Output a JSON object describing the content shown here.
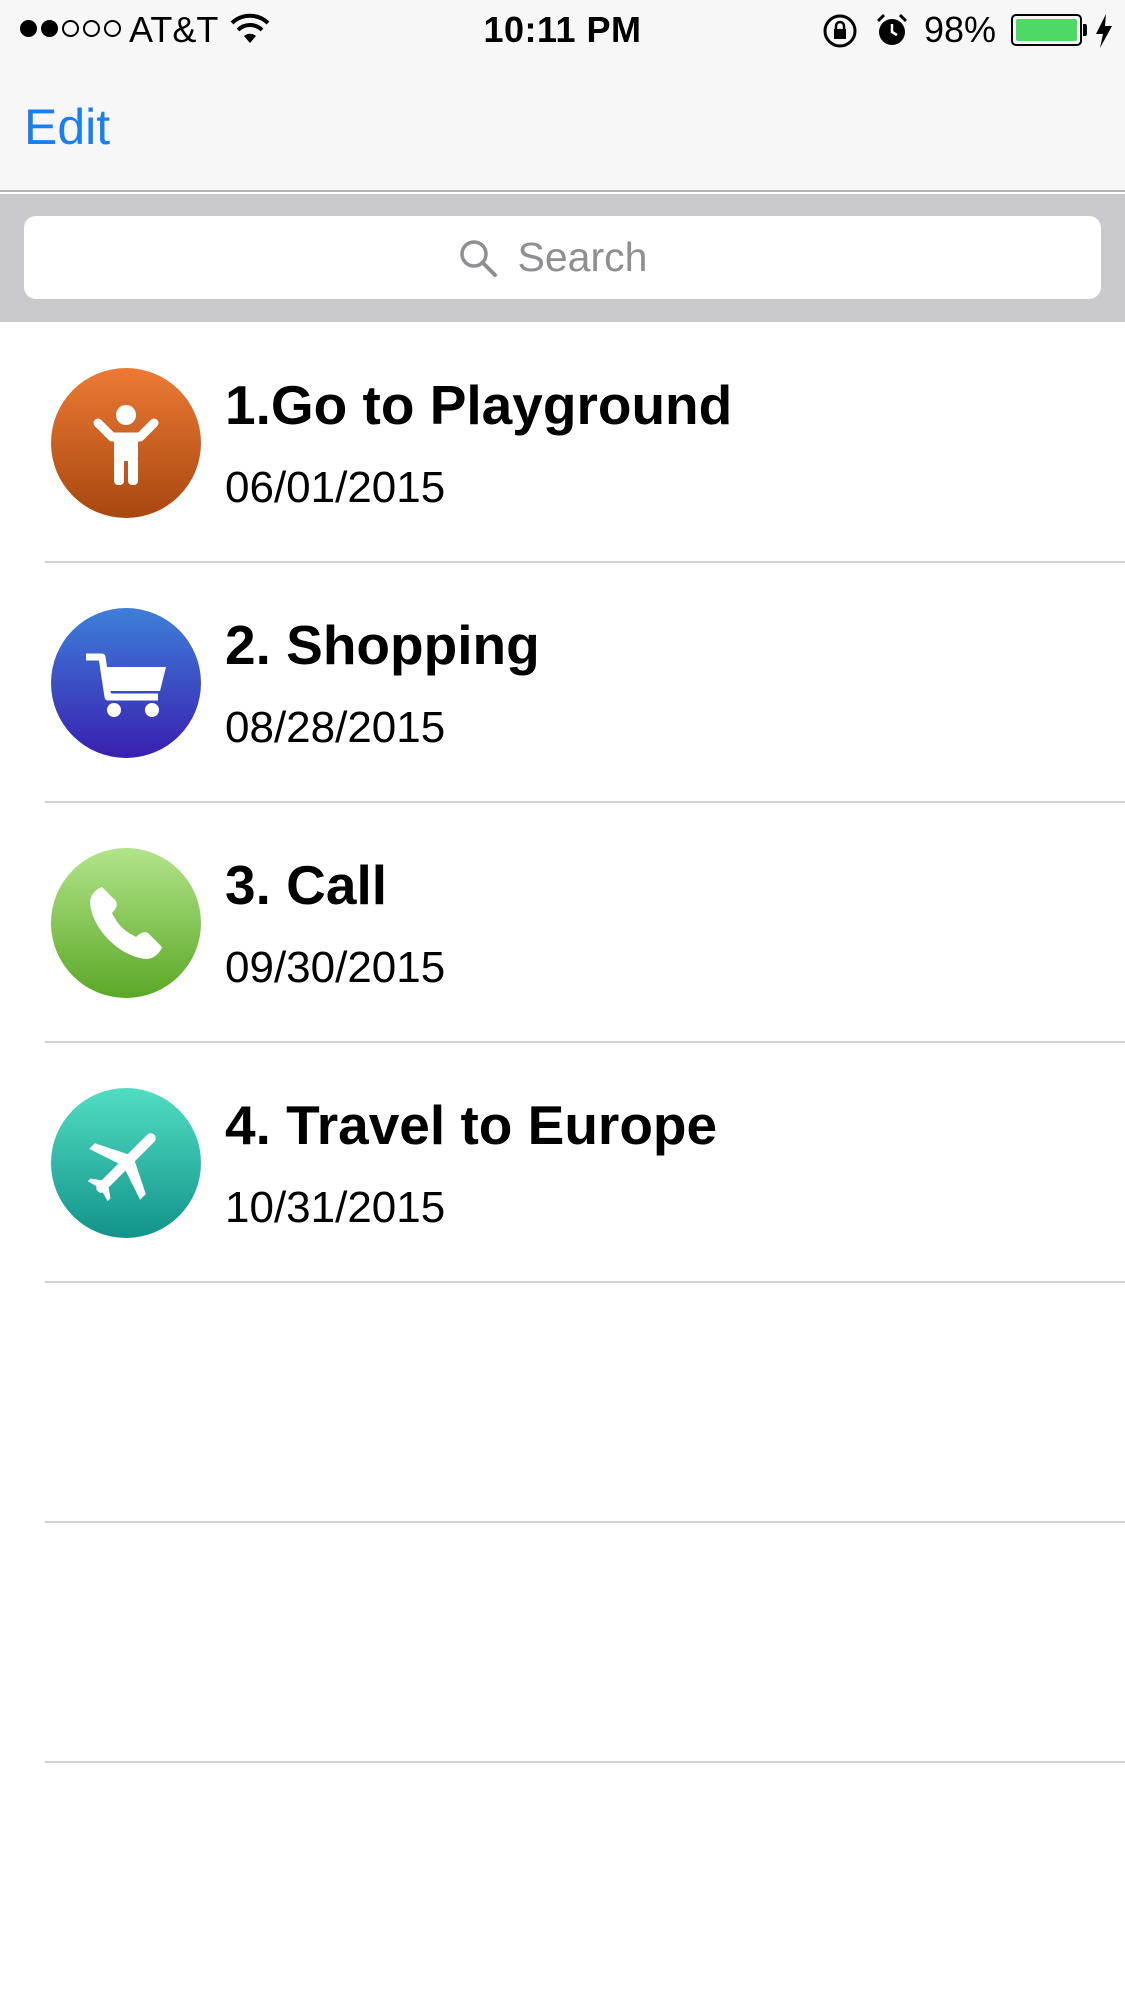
{
  "status_bar": {
    "carrier": "AT&T",
    "signal_filled": 2,
    "signal_total": 5,
    "time": "10:11 PM",
    "battery_percent": "98%",
    "battery_color": "#4cd964"
  },
  "nav": {
    "edit_label": "Edit",
    "accent_color": "#1a7ff1"
  },
  "search": {
    "placeholder": "Search"
  },
  "items": [
    {
      "title": "1.Go to Playground",
      "date": "06/01/2015",
      "icon": "child-icon",
      "colors": [
        "#ec7a35",
        "#a8470f"
      ]
    },
    {
      "title": "2. Shopping",
      "date": "08/28/2015",
      "icon": "shopping-cart-icon",
      "colors": [
        "#3e7fd9",
        "#3a1fb0"
      ]
    },
    {
      "title": "3. Call",
      "date": "09/30/2015",
      "icon": "phone-icon",
      "colors": [
        "#b3e48a",
        "#5aa826"
      ]
    },
    {
      "title": "4. Travel to Europe",
      "date": "10/31/2015",
      "icon": "airplane-icon",
      "colors": [
        "#52ddc3",
        "#12938a"
      ]
    }
  ]
}
